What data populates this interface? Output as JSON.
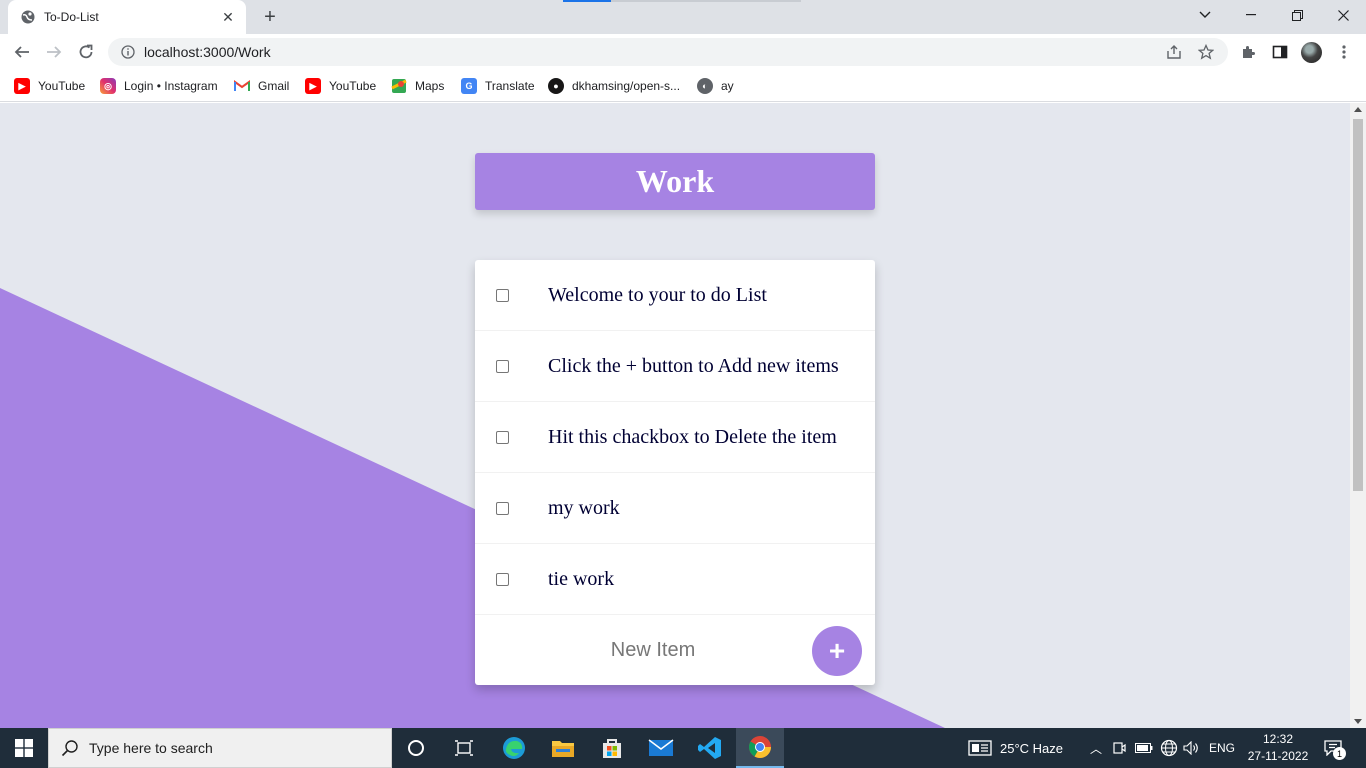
{
  "browser": {
    "tab_title": "To-Do-List",
    "url": "localhost:3000/Work",
    "bookmarks": [
      {
        "label": "YouTube",
        "icon": "youtube-icon"
      },
      {
        "label": "Login • Instagram",
        "icon": "instagram-icon"
      },
      {
        "label": "Gmail",
        "icon": "gmail-icon"
      },
      {
        "label": "YouTube",
        "icon": "youtube-icon"
      },
      {
        "label": "Maps",
        "icon": "maps-icon"
      },
      {
        "label": "Translate",
        "icon": "translate-icon"
      },
      {
        "label": "dkhamsing/open-s...",
        "icon": "github-icon"
      },
      {
        "label": "ay",
        "icon": "globe-icon"
      }
    ]
  },
  "page": {
    "heading": "Work",
    "items": [
      {
        "text": "Welcome to your to do List",
        "checked": false
      },
      {
        "text": "Click the + button to Add new items",
        "checked": false
      },
      {
        "text": "Hit this chackbox to Delete the item",
        "checked": false
      },
      {
        "text": "my work",
        "checked": false
      },
      {
        "text": "tie work",
        "checked": false
      }
    ],
    "new_item_placeholder": "New Item",
    "add_button_label": "+"
  },
  "colors": {
    "accent": "#a683e3",
    "background": "#e4e7ee",
    "text": "#000033"
  },
  "taskbar": {
    "search_placeholder": "Type here to search",
    "weather": "25°C  Haze",
    "language": "ENG",
    "time": "12:32",
    "date": "27-11-2022",
    "notification_count": "1"
  }
}
